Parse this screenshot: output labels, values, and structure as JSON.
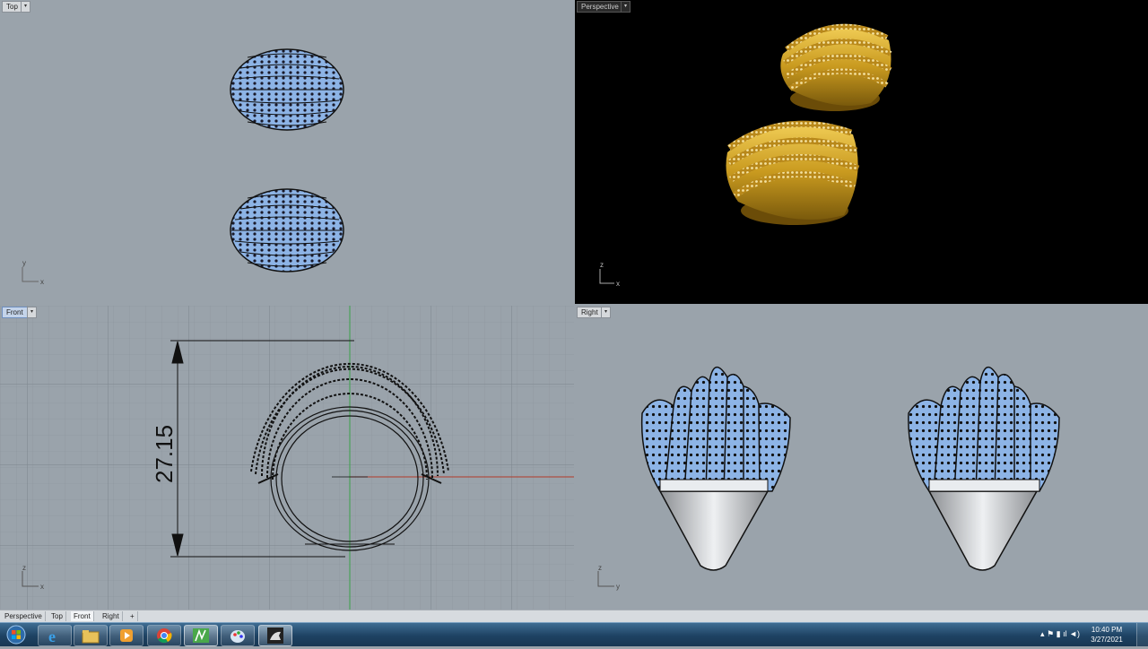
{
  "viewports": {
    "top": {
      "label": "Top",
      "axis_h": "x",
      "axis_v": "y"
    },
    "perspective": {
      "label": "Perspective",
      "axis_h": "x",
      "axis_v": "z"
    },
    "front": {
      "label": "Front",
      "axis_h": "x",
      "axis_v": "z",
      "dimension": "27.15"
    },
    "right": {
      "label": "Right",
      "axis_h": "y",
      "axis_v": "z"
    }
  },
  "tabs": [
    "Perspective",
    "Top",
    "Front",
    "Right"
  ],
  "active_tab": "Front",
  "add_tab_icon": "plus-icon",
  "taskbar": {
    "start_icon": "windows-start-icon",
    "apps": [
      {
        "name": "internet-explorer",
        "icon": "ie-icon"
      },
      {
        "name": "file-explorer",
        "icon": "folder-icon"
      },
      {
        "name": "media-player",
        "icon": "media-player-icon"
      },
      {
        "name": "chrome",
        "icon": "chrome-icon"
      },
      {
        "name": "matrix",
        "icon": "matrix-icon"
      },
      {
        "name": "paint",
        "icon": "paint-icon"
      },
      {
        "name": "rhino",
        "icon": "rhino-icon"
      }
    ],
    "time": "10:40 PM",
    "date": "3/27/2021"
  },
  "colors": {
    "viewport_bg": "#9aa3ab",
    "perspective_bg": "#000000",
    "gem_blue": "#8fb6e8",
    "gold": "#c99a1f"
  }
}
